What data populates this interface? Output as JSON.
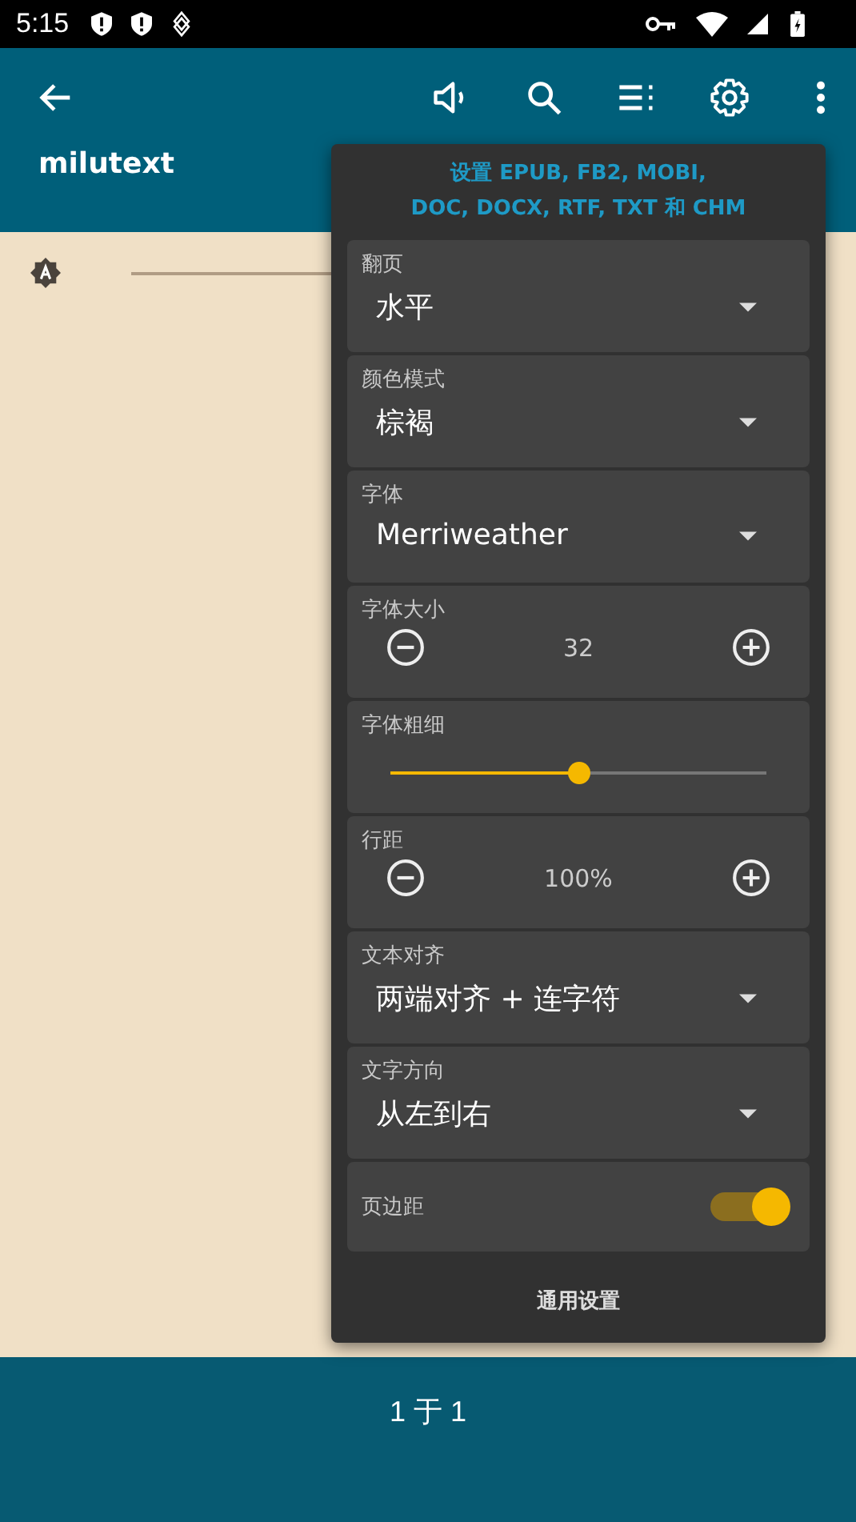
{
  "status_bar": {
    "time": "5:15"
  },
  "toolbar": {
    "title": "milutext"
  },
  "settings_popup": {
    "title": "设置 EPUB, FB2, MOBI,\nDOC, DOCX, RTF, TXT 和 CHM",
    "rows": [
      {
        "kind": "select",
        "label": "翻页",
        "value": "水平"
      },
      {
        "kind": "select",
        "label": "颜色模式",
        "value": "棕褐"
      },
      {
        "kind": "select",
        "label": "字体",
        "value": "Merriweather"
      },
      {
        "kind": "stepper",
        "label": "字体大小",
        "value": "32"
      },
      {
        "kind": "slider",
        "label": "字体粗细",
        "level": 0.5
      },
      {
        "kind": "stepper",
        "label": "行距",
        "value": "100%"
      },
      {
        "kind": "select",
        "label": "文本对齐",
        "value": "两端对齐 + 连字符"
      },
      {
        "kind": "select",
        "label": "文字方向",
        "value": "从左到右"
      },
      {
        "kind": "toggle",
        "label": "页边距",
        "on": true
      }
    ],
    "footer_button": "通用设置"
  },
  "bottom_bar": {
    "page": "1 于 1"
  }
}
